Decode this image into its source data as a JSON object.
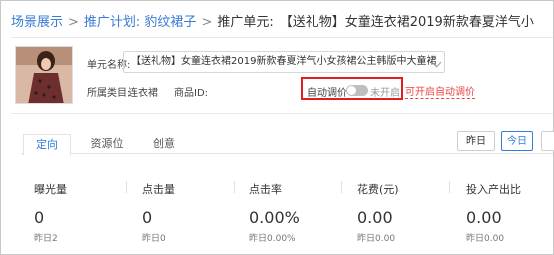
{
  "breadcrumb": {
    "root": "场景展示",
    "plan": "推广计划: 豹纹裙子",
    "unit_prefix": "推广单元:",
    "unit_title": "【送礼物】女童连衣裙2019新款春夏洋气小"
  },
  "unit": {
    "name_label": "单元名称:",
    "name_value": "【送礼物】女童连衣裙2019新款春夏洋气小女孩裙公主韩版中大童裙",
    "category_label": "所属类目:",
    "category_value": "连衣裙",
    "product_id_label": "商品ID:",
    "auto_bid_label": "自动调价",
    "auto_bid_status": "未开启",
    "auto_bid_link": "可开启自动调价"
  },
  "tabs": [
    "定向",
    "资源位",
    "创意"
  ],
  "date_buttons": {
    "yesterday": "昨日",
    "today": "今日"
  },
  "metrics": [
    {
      "title": "曝光量",
      "value": "0",
      "sub": "昨日2"
    },
    {
      "title": "点击量",
      "value": "0",
      "sub": "昨日0"
    },
    {
      "title": "点击率",
      "value": "0.00%",
      "sub": "昨日0.00%"
    },
    {
      "title": "花费(元)",
      "value": "0.00",
      "sub": "昨日0.00"
    },
    {
      "title": "投入产出比",
      "value": "0.00",
      "sub": "昨日0.00"
    }
  ],
  "colors": {
    "link": "#3a7bd5",
    "accent": "#2f7ee0",
    "highlight": "#e02020",
    "warning": "#e84545"
  }
}
